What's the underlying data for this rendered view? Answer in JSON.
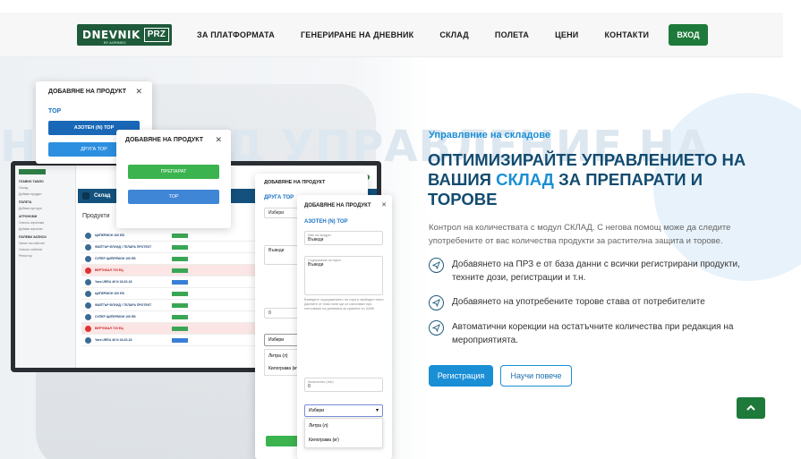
{
  "brand": {
    "name": "DNEVNIK",
    "box": "PRZ",
    "sub": "BY AGRINEO"
  },
  "nav": {
    "items": [
      "ЗА ПЛАТФОРМАТА",
      "ГЕНЕРИРАНЕ НА ДНЕВНИК",
      "СКЛАД",
      "ПОЛЕТА",
      "ЦЕНИ",
      "КОНТАКТИ"
    ],
    "login": "ВХОД"
  },
  "background_text": "НА СКЛАД УПРАВЛЕНИЕ НА",
  "hero": {
    "subtitle": "Управлвние на складове",
    "heading_part1": "ОПТИМИЗИРАЙТЕ УПРАВЛЕНИЕТО НА ВАШИЯ ",
    "heading_accent": "СКЛАД",
    "heading_part2": " ЗА ПРЕПАРАТИ И ТОРОВЕ",
    "intro": "Контрол на количествата с модул СКЛАД. С негова помощ може да следите употребените от вас количества продукти за растителна защита и торове.",
    "features": [
      "Добавянето на ПРЗ е от база данни с всички регистрирани продукти, техните дози, регистрации и т.н.",
      "Добавянето на употребените торове става от потребителите",
      "Автоматични корекции на остатъчните количества при редакция на мероприятията."
    ],
    "register_button": "Регистрация",
    "learn_more_button": "Научи повече"
  },
  "laptop": {
    "header": "Склад",
    "title": "Продукти",
    "sidebar": {
      "sections": [
        {
          "head": "ГЛАВНО ТАБЛО",
          "items": [
            "Склад",
            "Добави продукт"
          ]
        },
        {
          "head": "ПОЛЕТА",
          "items": [
            "Добави култура"
          ]
        },
        {
          "head": "АГРОНОМИ",
          "items": [
            "Списък агрономи",
            "Добави агроном"
          ]
        },
        {
          "head": "ПОЛЕВИ ЗАПИСИ",
          "items": [
            "Запис на събитие",
            "Списък събития",
            "Регистър"
          ]
        }
      ]
    },
    "rows": [
      {
        "name": "ЦИПЕРМОН 100 ЕБ",
        "tag": "g",
        "red": false
      },
      {
        "name": "ФАЙТЪР ФЛУИД / ТЕЛАРА ПРОТЕКТ",
        "tag": "g",
        "red": false
      },
      {
        "name": "СУПЕР ЦИПЕРМОН 100 ЕБ",
        "tag": "g",
        "red": false
      },
      {
        "name": "ВЕРТИКАЛ 720 ЕЦ",
        "tag": "g",
        "red": true
      },
      {
        "name": "Yara UREA 46 N 18-20-18",
        "tag": "b",
        "red": false
      },
      {
        "name": "ЦИПЕРМОН 100 ЕБ",
        "tag": "g",
        "red": false
      },
      {
        "name": "ФАЙТЪР ФЛУИД / ТЕЛАРА ПРОТЕКТ",
        "tag": "g",
        "red": false
      },
      {
        "name": "СУПЕР ЦИПЕРМОН 100 ЕБ",
        "tag": "g",
        "red": false
      },
      {
        "name": "ВЕРТИКАЛ 720 ЕЦ",
        "tag": "g",
        "red": true
      },
      {
        "name": "Yara UREA 46 N 18-20-18",
        "tag": "b",
        "red": false
      }
    ]
  },
  "modal1": {
    "title": "ДОБАВЯНЕ НА ПРОДУКТ",
    "label": "ТОР",
    "option1": "АЗОТЕН (N) ТОР",
    "option2": "ДРУГА ТОР"
  },
  "modal2": {
    "title": "ДОБАВЯНЕ НА ПРОДУКТ",
    "option1": "ПРЕПАРАТ",
    "option2": "ТОР"
  },
  "modal3": {
    "title": "ДОБАВЯНЕ НА ПРОДУКТ",
    "label": "ДРУГА ТОР",
    "select": "Избери",
    "field2": "Въведи",
    "field3": "0",
    "unit_select": "Избери",
    "units": [
      "Литра (л)",
      "Килограма (кг)"
    ]
  },
  "modal4": {
    "title": "ДОБАВЯНЕ НА ПРОДУКТ",
    "label": "АЗОТЕН (N) ТОР",
    "name_label": "Име на продукт",
    "name_value": "Въведи",
    "content_label": "Съдържание на торта",
    "content_value": "Въведи",
    "hint": "Въведете съдържанието на тора в свободен текст. Данните от това поле ще се използват при попълване на дневника за хранене по ХАКК",
    "qty_label": "Количество (л/кг)",
    "qty_value": "0",
    "unit_label": "Мерна единица (л/кг)",
    "unit_select": "Избери",
    "units": [
      "Литра (л)",
      "Килограма (кг)"
    ]
  },
  "colors": {
    "primary": "#1a8fd6",
    "dark": "#124b70",
    "green": "#1e7a3a"
  }
}
